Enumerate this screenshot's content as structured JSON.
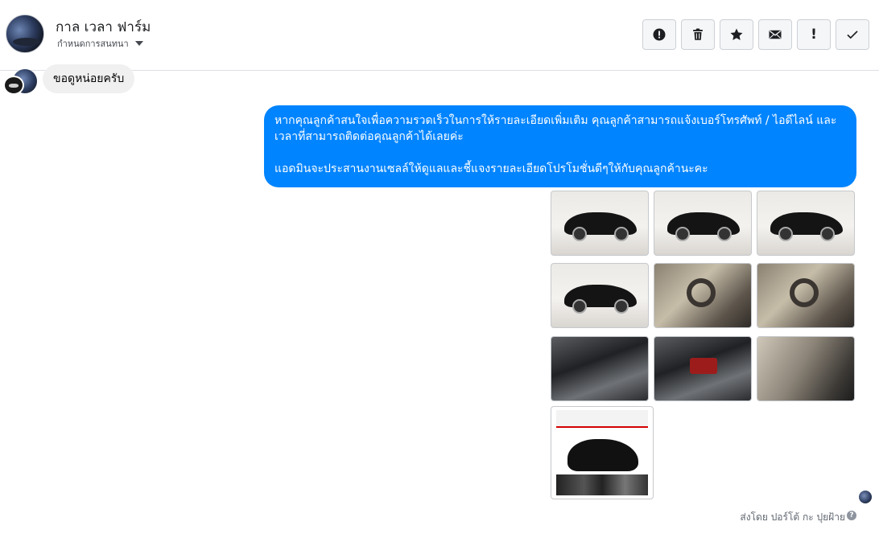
{
  "header": {
    "page_name": "กาล เวลา ฟาร์ม",
    "assign_label": "กำหนดการสนทนา",
    "toolbar": [
      {
        "name": "report-spam-button",
        "icon": "exclamation-circle-icon"
      },
      {
        "name": "delete-button",
        "icon": "trash-icon"
      },
      {
        "name": "star-button",
        "icon": "star-icon"
      },
      {
        "name": "mark-unread-button",
        "icon": "envelope-icon"
      },
      {
        "name": "follow-up-button",
        "icon": "exclamation-icon",
        "glyph": "!"
      },
      {
        "name": "mark-done-button",
        "icon": "check-icon"
      }
    ]
  },
  "messages": {
    "incoming_text": "ขอดูหน่อยครับ",
    "outgoing_line1": "หากคุณลูกค้าสนใจเพื่อความรวดเร็วในการให้รายละเอียดเพิ่มเติม คุณลูกค้าสามารถแจ้งเบอร์โทรศัพท์ / ไอดีไลน์ และเวลาที่สามารถติดต่อคุณลูกค้าได้เลยค่ะ",
    "outgoing_line2": "แอดมินจะประสานงานเซลล์ให้ดูแลและชี้แจงรายละเอียดโปรโมชั่นดีๆให้กับคุณลูกค้านะคะ"
  },
  "footer": {
    "sent_by": "ส่งโดย ปอร์โต้ กะ ปุยฝ้าย",
    "help_glyph": "?"
  },
  "colors": {
    "outgoing_bubble": "#0084ff",
    "incoming_bubble": "#f0f0f0"
  }
}
